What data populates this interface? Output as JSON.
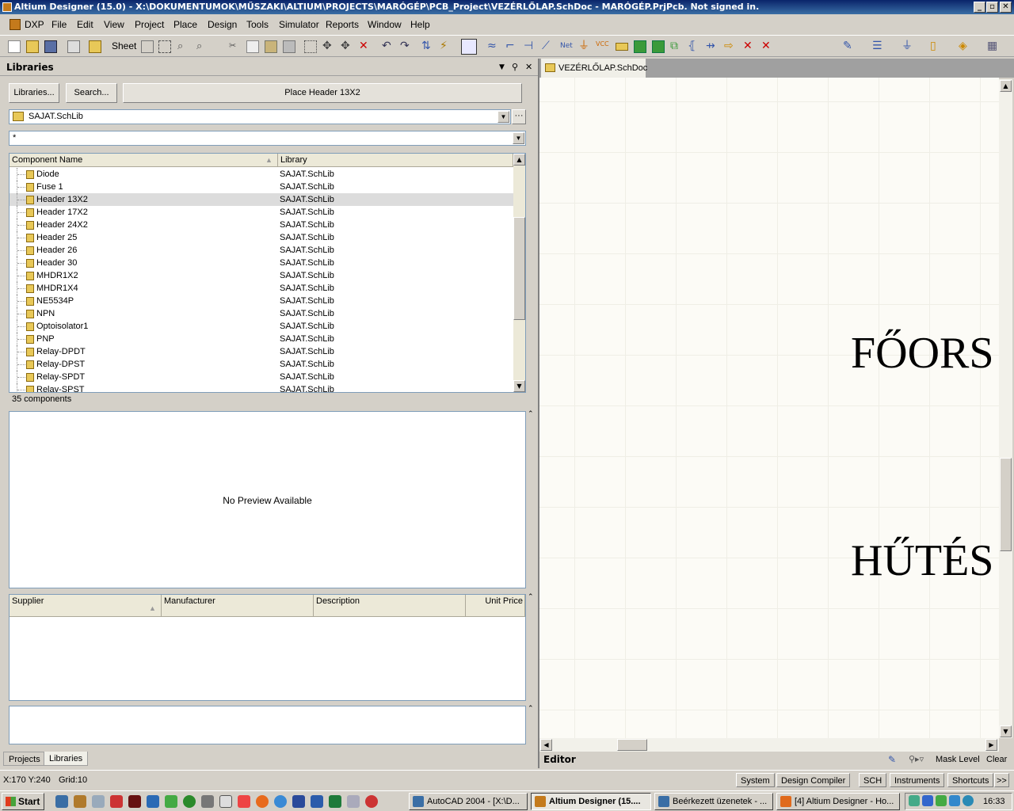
{
  "window": {
    "title": "Altium Designer (15.0) - X:\\DOKUMENTUMOK\\MŰSZAKI\\ALTIUM\\PROJECTS\\MARÓGÉP\\PCB_Project\\VEZÉRLŐLAP.SchDoc - MARÓGÉP.PrjPcb. Not signed in.",
    "minimize": "_",
    "restore": "▫",
    "close": "✕"
  },
  "menu": {
    "items": [
      "DXP",
      "File",
      "Edit",
      "View",
      "Project",
      "Place",
      "Design",
      "Tools",
      "Simulator",
      "Reports",
      "Window",
      "Help"
    ]
  },
  "toolbar": {
    "sheet_label": "Sheet"
  },
  "libraries": {
    "panel_title": "Libraries",
    "libraries_button": "Libraries...",
    "search_button": "Search...",
    "place_button": "Place Header 13X2",
    "selected_library": "SAJAT.SchLib",
    "filter_value": "*",
    "columns": {
      "name": "Component Name",
      "library": "Library"
    },
    "components": [
      {
        "name": "Diode",
        "library": "SAJAT.SchLib"
      },
      {
        "name": "Fuse 1",
        "library": "SAJAT.SchLib"
      },
      {
        "name": "Header 13X2",
        "library": "SAJAT.SchLib",
        "selected": true
      },
      {
        "name": "Header 17X2",
        "library": "SAJAT.SchLib"
      },
      {
        "name": "Header 24X2",
        "library": "SAJAT.SchLib"
      },
      {
        "name": "Header 25",
        "library": "SAJAT.SchLib"
      },
      {
        "name": "Header 26",
        "library": "SAJAT.SchLib"
      },
      {
        "name": "Header 30",
        "library": "SAJAT.SchLib"
      },
      {
        "name": "MHDR1X2",
        "library": "SAJAT.SchLib"
      },
      {
        "name": "MHDR1X4",
        "library": "SAJAT.SchLib"
      },
      {
        "name": "NE5534P",
        "library": "SAJAT.SchLib"
      },
      {
        "name": "NPN",
        "library": "SAJAT.SchLib"
      },
      {
        "name": "Optoisolator1",
        "library": "SAJAT.SchLib"
      },
      {
        "name": "PNP",
        "library": "SAJAT.SchLib"
      },
      {
        "name": "Relay-DPDT",
        "library": "SAJAT.SchLib"
      },
      {
        "name": "Relay-DPST",
        "library": "SAJAT.SchLib"
      },
      {
        "name": "Relay-SPDT",
        "library": "SAJAT.SchLib"
      },
      {
        "name": "Relay-SPST",
        "library": "SAJAT.SchLib"
      }
    ],
    "component_count": "35 components",
    "preview_text": "No Preview Available",
    "supplier_columns": {
      "supplier": "Supplier",
      "manufacturer": "Manufacturer",
      "description": "Description",
      "unit_price": "Unit Price"
    }
  },
  "panel_tabs": {
    "projects": "Projects",
    "libraries": "Libraries"
  },
  "document": {
    "tab_title": "VEZÉRLŐLAP.SchDoc",
    "text1": "FŐORS",
    "text2": "HŰTÉS"
  },
  "editor_bar": {
    "editor_label": "Editor",
    "mask_level": "Mask Level",
    "clear": "Clear"
  },
  "status": {
    "coords": "X:170 Y:240",
    "grid": "Grid:10",
    "buttons": [
      "System",
      "Design Compiler",
      "SCH",
      "Instruments",
      "Shortcuts"
    ],
    "more": ">>"
  },
  "taskbar": {
    "start": "Start",
    "tasks": [
      {
        "label": "AutoCAD 2004 - [X:\\D...",
        "color": "#3a6ea5"
      },
      {
        "label": "Altium Designer (15....",
        "color": "#c47a1c",
        "active": true
      },
      {
        "label": "Beérkezett üzenetek - ...",
        "color": "#3a6ea5"
      },
      {
        "label": "[4] Altium Designer - Ho...",
        "color": "#e06a1c"
      }
    ],
    "clock": "16:33"
  },
  "colors": {
    "titlebar_start": "#0a246a",
    "titlebar_end": "#3a6ea5",
    "selected_row": "#dcdcdc",
    "canvas_bg": "#fcfbf6"
  }
}
